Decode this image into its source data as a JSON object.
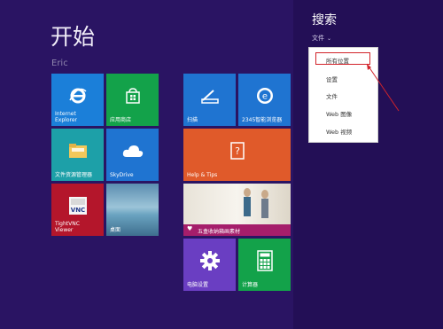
{
  "start": {
    "title": "开始",
    "user": "Eric"
  },
  "tiles": {
    "ie": {
      "label": "Internet\nExplorer",
      "color": "#1b7fd9"
    },
    "store": {
      "label": "应用商店",
      "color": "#13a24a"
    },
    "scan": {
      "label": "扫描",
      "color": "#1f74d1"
    },
    "browser2345": {
      "label": "2345智能浏览器",
      "color": "#1f74d1"
    },
    "explorer": {
      "label": "文件资源管理器",
      "color": "#1da0a8"
    },
    "skydrive": {
      "label": "SkyDrive",
      "color": "#1f74d1"
    },
    "help": {
      "label": "Help & Tips",
      "color": "#e05a2a"
    },
    "tightvnc": {
      "label": "TightVNC\nViewer",
      "color": "#b4162b"
    },
    "desktop": {
      "label": "桌面",
      "color": "#3f7ea5"
    },
    "photo": {
      "label": "五盒收纳箱画素材",
      "color": "#a51e6b"
    },
    "settings": {
      "label": "电脑设置",
      "color": "#6a3ec2"
    },
    "calc": {
      "label": "计算器",
      "color": "#13a24a"
    }
  },
  "search": {
    "title": "搜索",
    "scope": "文件",
    "options": [
      "所有位置",
      "设置",
      "文件",
      "Web 图像",
      "Web 视频"
    ],
    "highlight_color": "#d2232a"
  }
}
